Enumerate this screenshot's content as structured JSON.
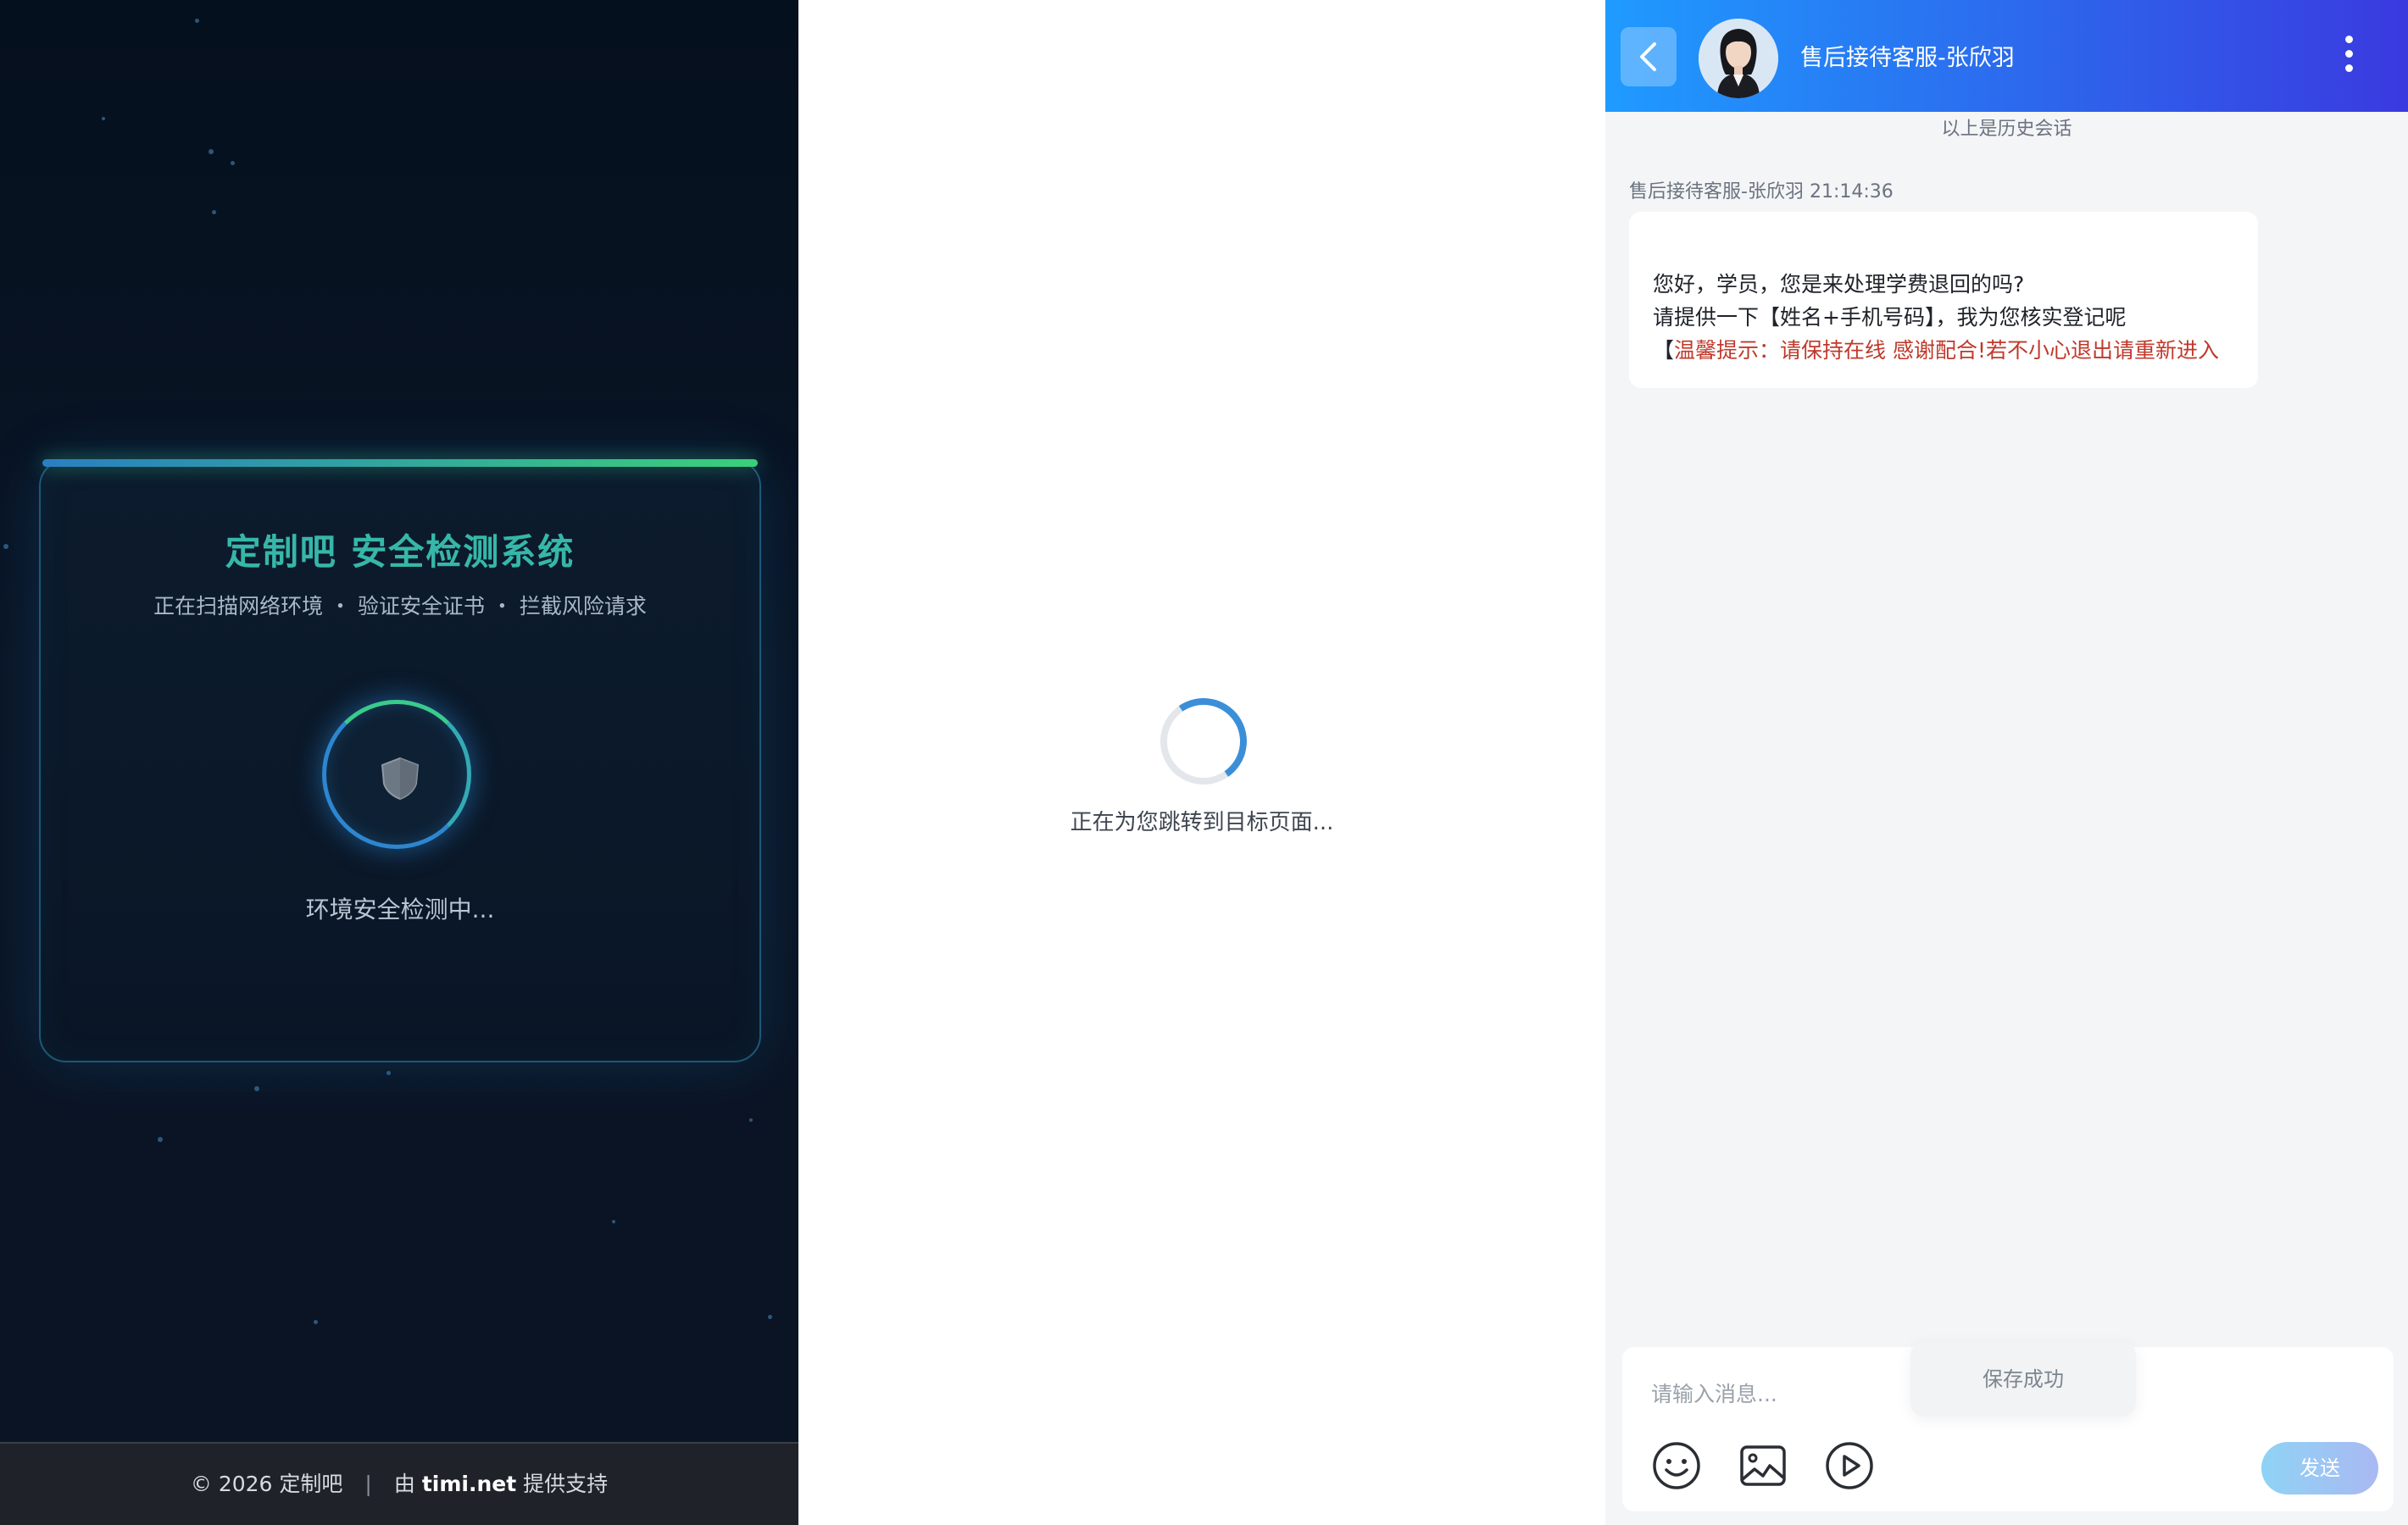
{
  "security_panel": {
    "title": "定制吧 安全检测系统",
    "subtitle": "正在扫描网络环境 ・ 验证安全证书 ・ 拦截风险请求",
    "status": "环境安全检测中...",
    "footer_copyright": "© 2026 定制吧",
    "footer_divider": "|",
    "footer_by": "由",
    "footer_brand": "timi.net",
    "footer_support": "提供支持"
  },
  "redirect_panel": {
    "loading_text": "正在为您跳转到目标页面..."
  },
  "chat": {
    "agent_name": "售后接待客服-张欣羽",
    "history_label": "以上是历史会话",
    "message": {
      "sender": "售后接待客服-张欣羽",
      "time": "21:14:36",
      "line1": "您好，学员，您是来处理学费退回的吗?",
      "line2": "请提供一下【姓名+手机号码】，我为您核实登记呢",
      "warn_bracket": "【",
      "warn_text": "温馨提示：请保持在线 感谢配合!若不小心退出请重新进入"
    },
    "composer": {
      "placeholder": "请输入消息...",
      "value": "",
      "send_label": "发送",
      "toast": "保存成功"
    },
    "icons": [
      "back-icon",
      "more-icon",
      "emoji-icon",
      "image-icon",
      "video-icon",
      "shield-icon"
    ],
    "colors": {
      "header_start": "#1f9bff",
      "header_end": "#3a3adf",
      "warning_text": "#c0392b",
      "accent_green": "#3acb8c",
      "accent_blue": "#2d86cf"
    }
  }
}
